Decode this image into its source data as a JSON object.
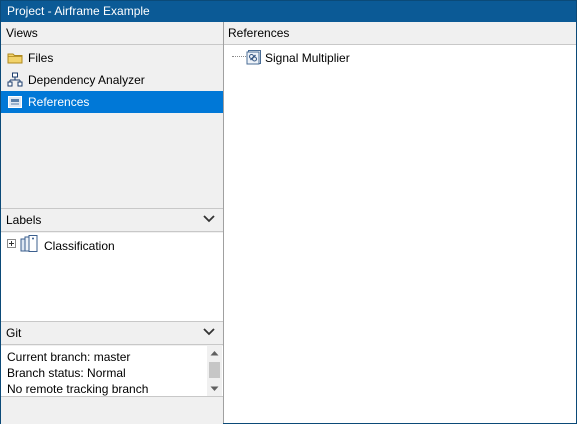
{
  "window": {
    "title": "Project - Airframe Example"
  },
  "views": {
    "header": "Views",
    "items": [
      {
        "label": "Files",
        "icon": "folder-icon",
        "selected": false
      },
      {
        "label": "Dependency Analyzer",
        "icon": "hierarchy-icon",
        "selected": false
      },
      {
        "label": "References",
        "icon": "references-icon",
        "selected": true
      }
    ]
  },
  "labels": {
    "header": "Labels",
    "items": [
      {
        "label": "Classification",
        "icon": "label-tag-icon",
        "expand": "plus-icon"
      }
    ]
  },
  "git": {
    "header": "Git",
    "lines": [
      "Current branch: master",
      "Branch status: Normal",
      "No remote tracking branch"
    ]
  },
  "references": {
    "header": "References",
    "items": [
      {
        "label": "Signal Multiplier",
        "icon": "project-reference-icon"
      }
    ]
  },
  "colors": {
    "titlebar": "#0b5a96",
    "selection": "#0078d7",
    "panel": "#f0f0f0"
  }
}
